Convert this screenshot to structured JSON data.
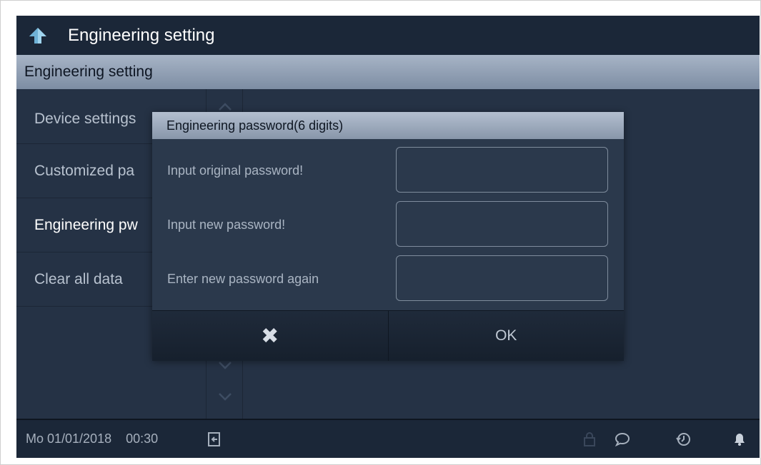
{
  "titlebar": {
    "title": "Engineering setting",
    "back_icon": "back-arrow-icon"
  },
  "section_header": "Engineering setting",
  "menu": {
    "items": [
      {
        "label": "Device settings",
        "active": false
      },
      {
        "label": "Customized pa",
        "active": false
      },
      {
        "label": "Engineering pw",
        "active": true
      },
      {
        "label": "Clear all data",
        "active": false
      }
    ]
  },
  "dialog": {
    "title": "Engineering password(6 digits)",
    "fields": [
      {
        "label": "Input original password!",
        "value": ""
      },
      {
        "label": "Input new password!",
        "value": ""
      },
      {
        "label": "Enter new password again",
        "value": ""
      }
    ],
    "cancel_glyph": "✖",
    "ok_label": "OK"
  },
  "statusbar": {
    "date": "Mo 01/01/2018",
    "time": "00:30",
    "icons": [
      "exit-door-icon",
      "lock-icon",
      "message-icon",
      "history-icon",
      "bell-icon"
    ]
  },
  "colors": {
    "background": "#253245",
    "bar": "#1b2738",
    "header_gradient_top": "#a7b4c6",
    "header_gradient_bottom": "#7d8da3",
    "accent_icon": "#9fd4ee"
  }
}
